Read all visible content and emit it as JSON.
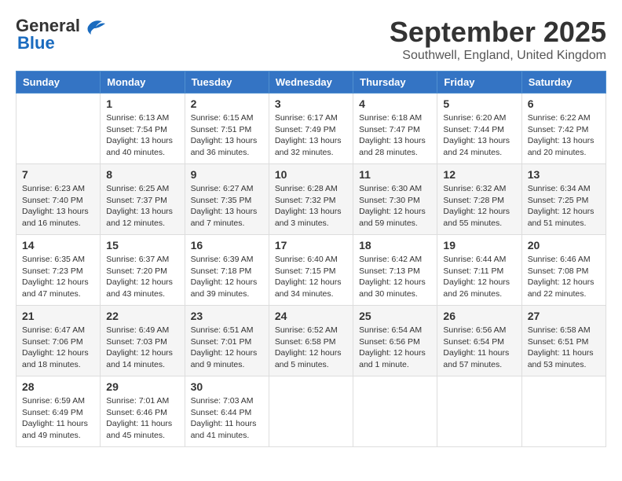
{
  "header": {
    "logo_general": "General",
    "logo_blue": "Blue",
    "month_title": "September 2025",
    "location": "Southwell, England, United Kingdom"
  },
  "columns": [
    "Sunday",
    "Monday",
    "Tuesday",
    "Wednesday",
    "Thursday",
    "Friday",
    "Saturday"
  ],
  "weeks": [
    {
      "days": [
        {
          "num": "",
          "info": ""
        },
        {
          "num": "1",
          "info": "Sunrise: 6:13 AM\nSunset: 7:54 PM\nDaylight: 13 hours\nand 40 minutes."
        },
        {
          "num": "2",
          "info": "Sunrise: 6:15 AM\nSunset: 7:51 PM\nDaylight: 13 hours\nand 36 minutes."
        },
        {
          "num": "3",
          "info": "Sunrise: 6:17 AM\nSunset: 7:49 PM\nDaylight: 13 hours\nand 32 minutes."
        },
        {
          "num": "4",
          "info": "Sunrise: 6:18 AM\nSunset: 7:47 PM\nDaylight: 13 hours\nand 28 minutes."
        },
        {
          "num": "5",
          "info": "Sunrise: 6:20 AM\nSunset: 7:44 PM\nDaylight: 13 hours\nand 24 minutes."
        },
        {
          "num": "6",
          "info": "Sunrise: 6:22 AM\nSunset: 7:42 PM\nDaylight: 13 hours\nand 20 minutes."
        }
      ]
    },
    {
      "days": [
        {
          "num": "7",
          "info": "Sunrise: 6:23 AM\nSunset: 7:40 PM\nDaylight: 13 hours\nand 16 minutes."
        },
        {
          "num": "8",
          "info": "Sunrise: 6:25 AM\nSunset: 7:37 PM\nDaylight: 13 hours\nand 12 minutes."
        },
        {
          "num": "9",
          "info": "Sunrise: 6:27 AM\nSunset: 7:35 PM\nDaylight: 13 hours\nand 7 minutes."
        },
        {
          "num": "10",
          "info": "Sunrise: 6:28 AM\nSunset: 7:32 PM\nDaylight: 13 hours\nand 3 minutes."
        },
        {
          "num": "11",
          "info": "Sunrise: 6:30 AM\nSunset: 7:30 PM\nDaylight: 12 hours\nand 59 minutes."
        },
        {
          "num": "12",
          "info": "Sunrise: 6:32 AM\nSunset: 7:28 PM\nDaylight: 12 hours\nand 55 minutes."
        },
        {
          "num": "13",
          "info": "Sunrise: 6:34 AM\nSunset: 7:25 PM\nDaylight: 12 hours\nand 51 minutes."
        }
      ]
    },
    {
      "days": [
        {
          "num": "14",
          "info": "Sunrise: 6:35 AM\nSunset: 7:23 PM\nDaylight: 12 hours\nand 47 minutes."
        },
        {
          "num": "15",
          "info": "Sunrise: 6:37 AM\nSunset: 7:20 PM\nDaylight: 12 hours\nand 43 minutes."
        },
        {
          "num": "16",
          "info": "Sunrise: 6:39 AM\nSunset: 7:18 PM\nDaylight: 12 hours\nand 39 minutes."
        },
        {
          "num": "17",
          "info": "Sunrise: 6:40 AM\nSunset: 7:15 PM\nDaylight: 12 hours\nand 34 minutes."
        },
        {
          "num": "18",
          "info": "Sunrise: 6:42 AM\nSunset: 7:13 PM\nDaylight: 12 hours\nand 30 minutes."
        },
        {
          "num": "19",
          "info": "Sunrise: 6:44 AM\nSunset: 7:11 PM\nDaylight: 12 hours\nand 26 minutes."
        },
        {
          "num": "20",
          "info": "Sunrise: 6:46 AM\nSunset: 7:08 PM\nDaylight: 12 hours\nand 22 minutes."
        }
      ]
    },
    {
      "days": [
        {
          "num": "21",
          "info": "Sunrise: 6:47 AM\nSunset: 7:06 PM\nDaylight: 12 hours\nand 18 minutes."
        },
        {
          "num": "22",
          "info": "Sunrise: 6:49 AM\nSunset: 7:03 PM\nDaylight: 12 hours\nand 14 minutes."
        },
        {
          "num": "23",
          "info": "Sunrise: 6:51 AM\nSunset: 7:01 PM\nDaylight: 12 hours\nand 9 minutes."
        },
        {
          "num": "24",
          "info": "Sunrise: 6:52 AM\nSunset: 6:58 PM\nDaylight: 12 hours\nand 5 minutes."
        },
        {
          "num": "25",
          "info": "Sunrise: 6:54 AM\nSunset: 6:56 PM\nDaylight: 12 hours\nand 1 minute."
        },
        {
          "num": "26",
          "info": "Sunrise: 6:56 AM\nSunset: 6:54 PM\nDaylight: 11 hours\nand 57 minutes."
        },
        {
          "num": "27",
          "info": "Sunrise: 6:58 AM\nSunset: 6:51 PM\nDaylight: 11 hours\nand 53 minutes."
        }
      ]
    },
    {
      "days": [
        {
          "num": "28",
          "info": "Sunrise: 6:59 AM\nSunset: 6:49 PM\nDaylight: 11 hours\nand 49 minutes."
        },
        {
          "num": "29",
          "info": "Sunrise: 7:01 AM\nSunset: 6:46 PM\nDaylight: 11 hours\nand 45 minutes."
        },
        {
          "num": "30",
          "info": "Sunrise: 7:03 AM\nSunset: 6:44 PM\nDaylight: 11 hours\nand 41 minutes."
        },
        {
          "num": "",
          "info": ""
        },
        {
          "num": "",
          "info": ""
        },
        {
          "num": "",
          "info": ""
        },
        {
          "num": "",
          "info": ""
        }
      ]
    }
  ]
}
